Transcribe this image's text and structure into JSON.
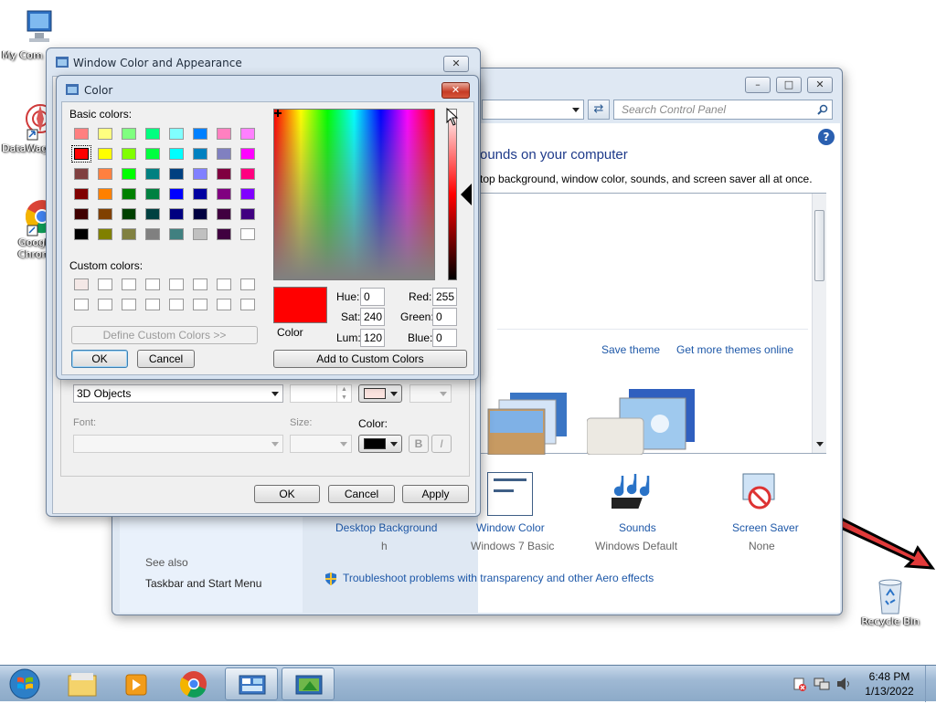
{
  "desktop": {
    "icons": [
      {
        "label": "My Com"
      },
      {
        "label": "DataWag"
      },
      {
        "label": "Googl Chron"
      },
      {
        "label": "Recycle Bin"
      }
    ]
  },
  "control_panel": {
    "search_placeholder": "Search Control Panel",
    "heading": "ounds on your computer",
    "subheading": "top background, window color, sounds, and screen saver all at once.",
    "save_theme": "Save theme",
    "get_more_themes": "Get more themes online",
    "bottom_items": [
      {
        "title": "Desktop Background",
        "value": "h"
      },
      {
        "title": "Window Color",
        "value": "Windows 7 Basic"
      },
      {
        "title": "Sounds",
        "value": "Windows Default"
      },
      {
        "title": "Screen Saver",
        "value": "None"
      }
    ],
    "see_also": "See also",
    "taskbar_link": "Taskbar and Start Menu",
    "troubleshoot": "Troubleshoot problems with transparency and other Aero effects"
  },
  "appearance_dialog": {
    "title": "Window Color and Appearance",
    "item_value": "3D Objects",
    "font_label": "Font:",
    "size_label": "Size:",
    "color_label": "Color:",
    "bold": "B",
    "italic": "I",
    "ok": "OK",
    "cancel": "Cancel",
    "apply": "Apply",
    "item_color": "#fbe3df",
    "font_color": "#000000"
  },
  "color_dialog": {
    "title": "Color",
    "basic_colors_label": "Basic colors:",
    "custom_colors_label": "Custom colors:",
    "define_custom": "Define Custom Colors >>",
    "ok": "OK",
    "cancel": "Cancel",
    "add_custom": "Add to Custom Colors",
    "color_solid_label": "Color",
    "hue_label": "Hue:",
    "hue": "0",
    "sat_label": "Sat:",
    "sat": "240",
    "lum_label": "Lum:",
    "lum": "120",
    "red_label": "Red:",
    "red": "255",
    "green_label": "Green:",
    "green": "0",
    "blue_label": "Blue:",
    "blue": "0",
    "current_color": "#ff0000",
    "basic_colors": [
      [
        "#ff8080",
        "#ffff80",
        "#80ff80",
        "#00ff80",
        "#80ffff",
        "#0080ff",
        "#ff80c0",
        "#ff80ff"
      ],
      [
        "#ff0000",
        "#ffff00",
        "#80ff00",
        "#00ff40",
        "#00ffff",
        "#0080c0",
        "#8080c0",
        "#ff00ff"
      ],
      [
        "#804040",
        "#ff8040",
        "#00ff00",
        "#008080",
        "#004080",
        "#8080ff",
        "#800040",
        "#ff0080"
      ],
      [
        "#800000",
        "#ff8000",
        "#008000",
        "#008040",
        "#0000ff",
        "#0000a0",
        "#800080",
        "#8000ff"
      ],
      [
        "#400000",
        "#804000",
        "#004000",
        "#004040",
        "#000080",
        "#000040",
        "#400040",
        "#400080"
      ],
      [
        "#000000",
        "#808000",
        "#808040",
        "#808080",
        "#408080",
        "#c0c0c0",
        "#400040",
        "#ffffff"
      ]
    ],
    "custom_colors": [
      [
        "#f4e8e6",
        "#ffffff",
        "#ffffff",
        "#ffffff",
        "#ffffff",
        "#ffffff",
        "#ffffff",
        "#ffffff"
      ],
      [
        "#ffffff",
        "#ffffff",
        "#ffffff",
        "#ffffff",
        "#ffffff",
        "#ffffff",
        "#ffffff",
        "#ffffff"
      ]
    ]
  },
  "taskbar": {
    "time": "6:48 PM",
    "date": "1/13/2022"
  }
}
